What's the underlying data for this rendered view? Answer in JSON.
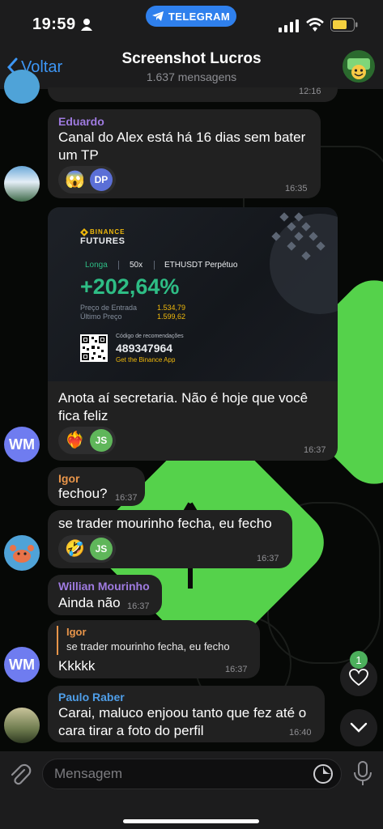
{
  "status": {
    "time": "19:59",
    "app_pill": "TELEGRAM"
  },
  "header": {
    "back_label": "Voltar",
    "title": "Screenshot Lucros",
    "subtitle": "1.637 mensagens"
  },
  "messages": [
    {
      "time": "12:16"
    },
    {
      "sender": "Eduardo",
      "sender_color": "#9f7be0",
      "lines": [
        "Canal do Alex está há 16 dias sem bater",
        "um TP"
      ],
      "reaction": {
        "emoji": "😱",
        "user": "DP"
      },
      "time": "16:35"
    },
    {
      "lines": [
        "Anota aí secretaria. Não é hoje que você",
        "fica feliz"
      ],
      "reaction": {
        "emoji": "❤️‍🔥",
        "user": "JS"
      },
      "time": "16:37",
      "avatar": "WM"
    },
    {
      "sender": "Igor",
      "sender_color": "#e8954a",
      "text": "fechou?",
      "time": "16:37"
    },
    {
      "text": "se trader mourinho fecha, eu fecho",
      "reaction": {
        "emoji": "🤣",
        "user": "JS"
      },
      "time": "16:37"
    },
    {
      "sender": "Willian Mourinho",
      "sender_color": "#9f7be0",
      "text": "Ainda não",
      "time": "16:37"
    },
    {
      "reply": {
        "sender": "Igor",
        "text": "se trader mourinho fecha, eu fecho"
      },
      "text": "Kkkkk",
      "time": "16:37",
      "avatar": "WM"
    },
    {
      "sender": "Paulo Raber",
      "sender_color": "#4f9ee8",
      "lines": [
        "Carai, maluco enjoou tanto que fez até o",
        "cara tirar a foto do perfil"
      ],
      "time": "16:40"
    }
  ],
  "binance": {
    "brand_top": "BINANCE",
    "brand_bottom": "FUTURES",
    "side": "Longa",
    "leverage": "50x",
    "pair": "ETHUSDT Perpétuo",
    "pnl": "+202,64%",
    "entry_label": "Preço de Entrada",
    "entry_value": "1.534,79",
    "last_label": "Último Preço",
    "last_value": "1.599,62",
    "ref_label": "Código de recomendações",
    "ref_code": "489347964",
    "ref_cta": "Get the Binance App",
    "accent": "#f0b90b",
    "profit_color": "#2ebd85"
  },
  "floating": {
    "reactions_count": "1"
  },
  "input": {
    "placeholder": "Mensagem"
  },
  "colors": {
    "accent": "#3d96f4",
    "bubble": "#212121",
    "wallpaper_green": "#55d24b"
  }
}
